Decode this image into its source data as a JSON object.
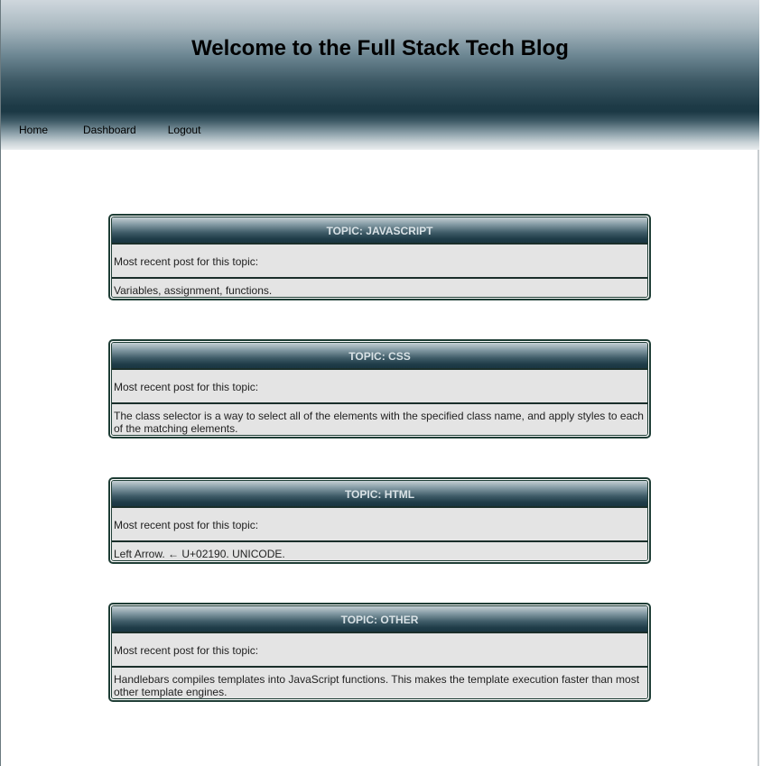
{
  "header": {
    "title": "Welcome to the Full Stack Tech Blog"
  },
  "nav": {
    "home": "Home",
    "dashboard": "Dashboard",
    "logout": "Logout"
  },
  "topics": [
    {
      "title": "TOPIC: JAVASCRIPT",
      "label": "Most recent post for this topic:",
      "post": "Variables, assignment, functions."
    },
    {
      "title": "TOPIC: CSS",
      "label": "Most recent post for this topic:",
      "post": "The class selector is a way to select all of the elements with the specified class name, and apply styles to each of the matching elements."
    },
    {
      "title": "TOPIC: HTML",
      "label": "Most recent post for this topic:",
      "post": "Left Arrow. ← U+02190. UNICODE."
    },
    {
      "title": "TOPIC: OTHER",
      "label": "Most recent post for this topic:",
      "post": "Handlebars compiles templates into JavaScript functions. This makes the template execution faster than most other template engines."
    }
  ]
}
